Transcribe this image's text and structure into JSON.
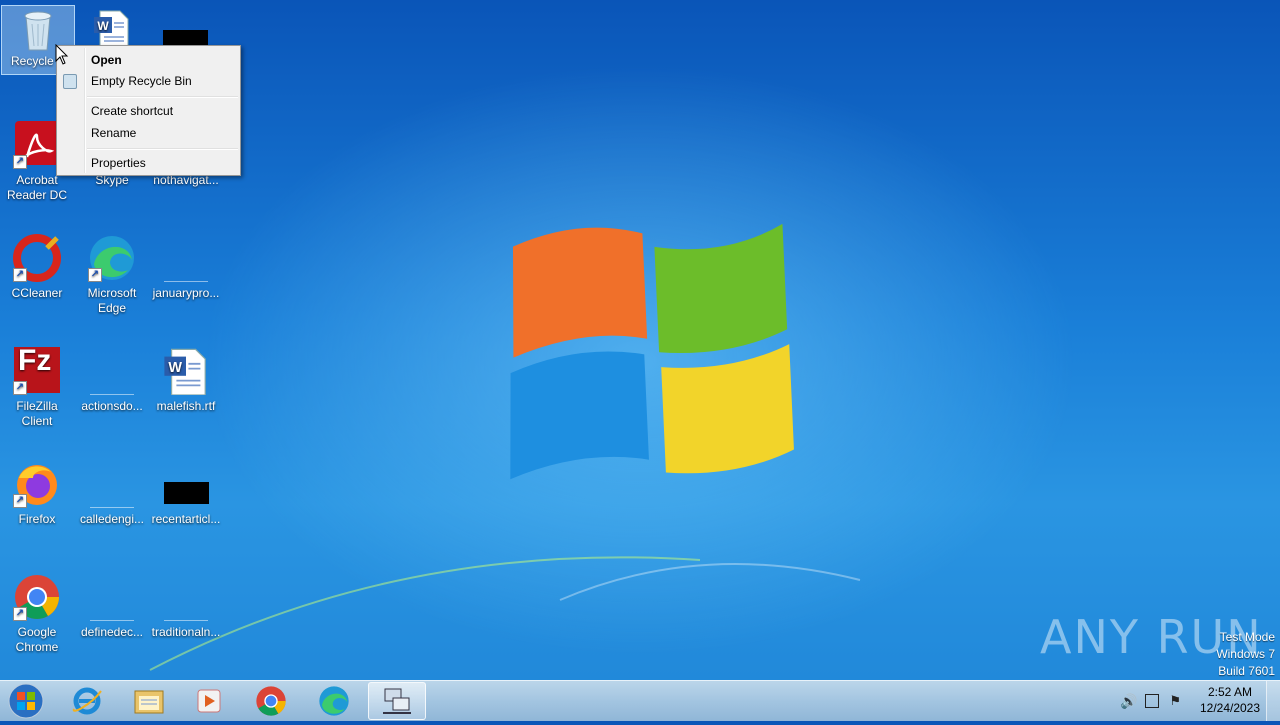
{
  "desktop": {
    "icons": [
      {
        "label": "Recycle Bin",
        "shown": "Recycle B"
      },
      {
        "label": ""
      },
      {
        "label": ""
      },
      {
        "label": "Acrobat Reader DC"
      },
      {
        "label": "Skype"
      },
      {
        "label": "nothavigat..."
      },
      {
        "label": "CCleaner"
      },
      {
        "label": "Microsoft Edge"
      },
      {
        "label": "januarypro..."
      },
      {
        "label": "FileZilla Client"
      },
      {
        "label": "actionsdo..."
      },
      {
        "label": "malefish.rtf"
      },
      {
        "label": "Firefox"
      },
      {
        "label": "calledengi..."
      },
      {
        "label": "recentarticl..."
      },
      {
        "label": "Google Chrome"
      },
      {
        "label": "definedec..."
      },
      {
        "label": "traditionaln..."
      }
    ]
  },
  "context_menu": {
    "items": [
      "Open",
      "Empty Recycle Bin",
      "Create shortcut",
      "Rename",
      "Properties"
    ]
  },
  "watermark": "ANY RUN",
  "test_mode": {
    "line1": "Test Mode",
    "line2": "Windows 7",
    "line3": "Build 7601"
  },
  "taskbar": {
    "pinned": [
      "start-orb-icon",
      "internet-explorer-icon",
      "file-explorer-icon",
      "media-player-icon",
      "chrome-icon",
      "edge-icon",
      "network-app-icon"
    ],
    "clock": {
      "time": "2:52 AM",
      "date": "12/24/2023"
    }
  }
}
